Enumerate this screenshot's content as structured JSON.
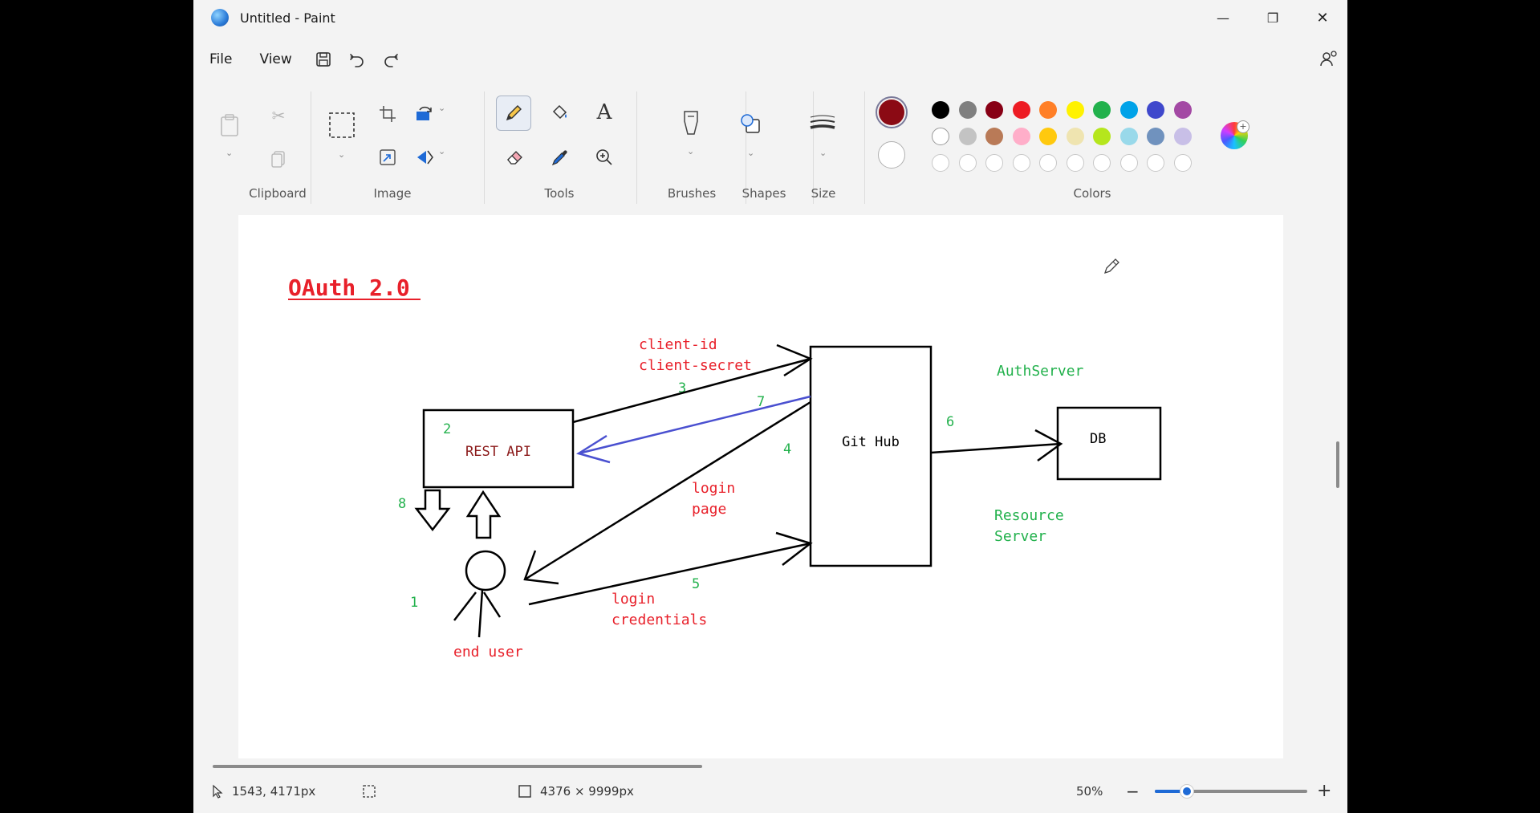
{
  "window": {
    "title": "Untitled - Paint",
    "controls": {
      "minimize": "—",
      "restore": "❐",
      "close": "✕"
    }
  },
  "menu": {
    "file": "File",
    "view": "View"
  },
  "ribbon": {
    "groups": {
      "clipboard": "Clipboard",
      "image": "Image",
      "tools": "Tools",
      "brushes": "Brushes",
      "shapes": "Shapes",
      "size": "Size",
      "colors": "Colors"
    },
    "primary_color": "#8b0a14",
    "secondary_color": "#ffffff",
    "palette_row1": [
      "#000000",
      "#7f7f7f",
      "#880015",
      "#ed1c24",
      "#ff7f27",
      "#fff200",
      "#22b14c",
      "#00a2e8",
      "#3f48cc",
      "#a349a4"
    ],
    "palette_row2": [
      "#ffffff",
      "#c3c3c3",
      "#b97a57",
      "#ffaec9",
      "#ffc90e",
      "#efe4b0",
      "#b5e61d",
      "#99d9ea",
      "#7092be",
      "#c8bfe7"
    ],
    "palette_row3_count": 10
  },
  "drawing": {
    "title": "OAuth 2.0",
    "client_id": "client-id",
    "client_secret": "client-secret",
    "rest_api": "REST API",
    "git_hub": "Git Hub",
    "db": "DB",
    "auth_server": "AuthServer",
    "resource_server_1": "Resource",
    "resource_server_2": "Server",
    "login_page_1": "login",
    "login_page_2": "page",
    "login_credentials_1": "login",
    "login_credentials_2": "credentials",
    "end_user": "end user",
    "steps": {
      "s1": "1",
      "s2": "2",
      "s3": "3",
      "s4": "4",
      "s5": "5",
      "s6": "6",
      "s7": "7",
      "s8": "8"
    },
    "colors": {
      "red": "#e8202a",
      "green": "#22b14c",
      "blue": "#4a50d0",
      "dark_red": "#8b1a1a",
      "black": "#000000"
    }
  },
  "status": {
    "cursor_pos": "1543, 4171px",
    "canvas_size": "4376 × 9999px",
    "zoom": "50%",
    "zoom_level": 0.5
  }
}
